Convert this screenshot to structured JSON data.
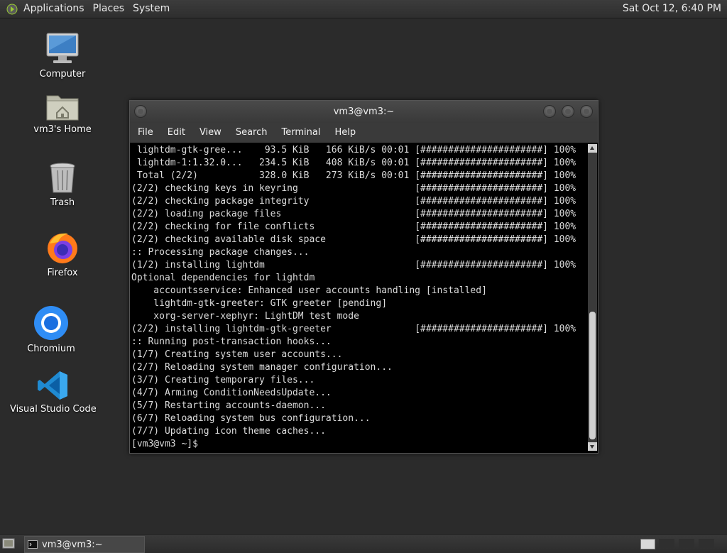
{
  "top_panel": {
    "menu": [
      "Applications",
      "Places",
      "System"
    ],
    "clock": "Sat Oct 12,  6:40 PM"
  },
  "desktop": {
    "icons": [
      {
        "label": "Computer",
        "icon": "computer-icon"
      },
      {
        "label": "vm3's Home",
        "icon": "home-folder-icon"
      },
      {
        "label": "Trash",
        "icon": "trash-icon"
      },
      {
        "label": "Firefox",
        "icon": "firefox-icon"
      },
      {
        "label": "Chromium",
        "icon": "chromium-icon"
      },
      {
        "label": "Visual Studio Code",
        "icon": "vscode-icon"
      }
    ]
  },
  "terminal": {
    "title": "vm3@vm3:~",
    "menu": [
      "File",
      "Edit",
      "View",
      "Search",
      "Terminal",
      "Help"
    ],
    "lines": [
      " lightdm-gtk-gree...    93.5 KiB   166 KiB/s 00:01 [######################] 100%",
      " lightdm-1:1.32.0...   234.5 KiB   408 KiB/s 00:01 [######################] 100%",
      " Total (2/2)           328.0 KiB   273 KiB/s 00:01 [######################] 100%",
      "(2/2) checking keys in keyring                     [######################] 100%",
      "(2/2) checking package integrity                   [######################] 100%",
      "(2/2) loading package files                        [######################] 100%",
      "(2/2) checking for file conflicts                  [######################] 100%",
      "(2/2) checking available disk space                [######################] 100%",
      ":: Processing package changes...",
      "(1/2) installing lightdm                           [######################] 100%",
      "Optional dependencies for lightdm",
      "    accountsservice: Enhanced user accounts handling [installed]",
      "    lightdm-gtk-greeter: GTK greeter [pending]",
      "    xorg-server-xephyr: LightDM test mode",
      "(2/2) installing lightdm-gtk-greeter               [######################] 100%",
      ":: Running post-transaction hooks...",
      "(1/7) Creating system user accounts...",
      "(2/7) Reloading system manager configuration...",
      "(3/7) Creating temporary files...",
      "(4/7) Arming ConditionNeedsUpdate...",
      "(5/7) Restarting accounts-daemon...",
      "(6/7) Reloading system bus configuration...",
      "(7/7) Updating icon theme caches...",
      "[vm3@vm3 ~]$ "
    ]
  },
  "taskbar": {
    "window_button": "vm3@vm3:~"
  }
}
